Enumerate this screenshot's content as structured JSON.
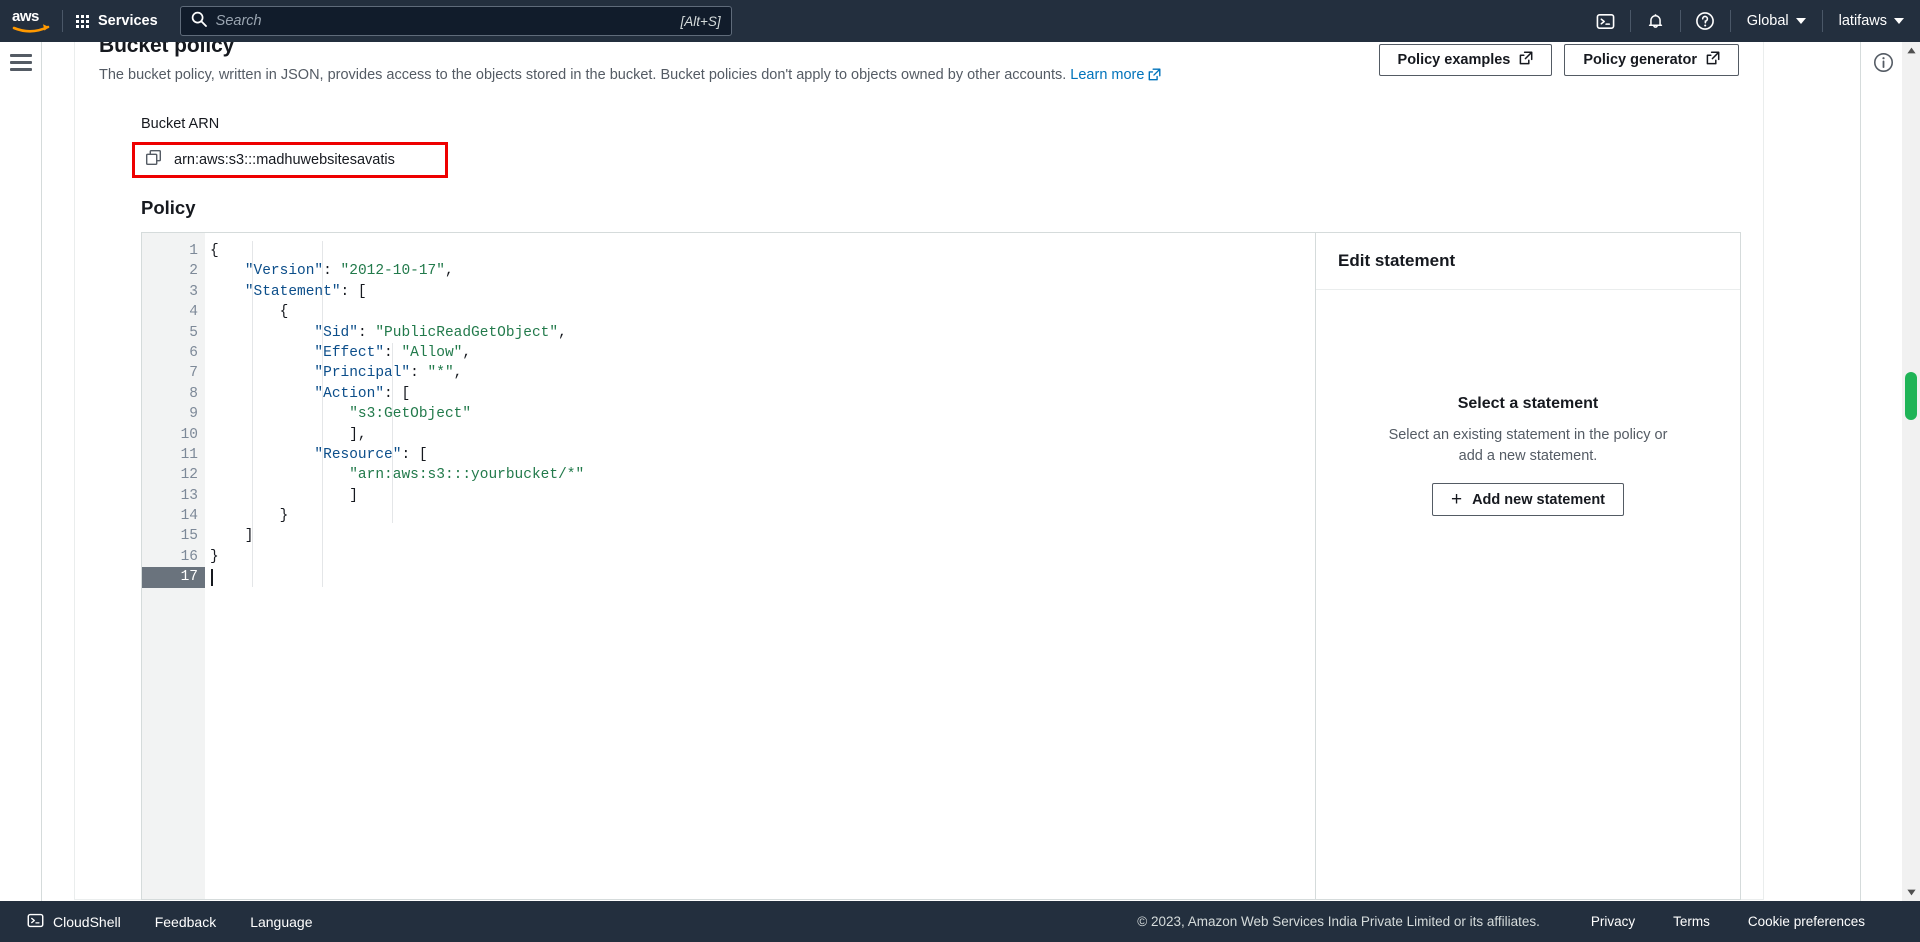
{
  "topnav": {
    "logo_alt": "aws-logo",
    "services_label": "Services",
    "search": {
      "placeholder": "Search",
      "value": "",
      "shortcut": "[Alt+S]"
    },
    "cloudshell_icon": "cloudshell-terminal-icon",
    "notifications_icon": "bell-icon",
    "help_icon": "question-circle-icon",
    "region_label": "Global",
    "account_label": "latifaws"
  },
  "leftrail": {
    "menu_icon": "hamburger-menu-icon"
  },
  "page": {
    "title": "Bucket policy",
    "description_before_link": "The bucket policy, written in JSON, provides access to the objects stored in the bucket. Bucket policies don't apply to objects owned by other accounts. ",
    "learn_more_label": "Learn more",
    "learn_more_icon": "external-link-icon",
    "policy_examples_label": "Policy examples",
    "policy_generator_label": "Policy generator",
    "external_icon": "external-link-icon"
  },
  "bucket_arn": {
    "label": "Bucket ARN",
    "value": "arn:aws:s3:::madhuwebsitesavatis",
    "copy_icon": "copy-icon",
    "highlight_color": "#ee0000"
  },
  "policy_section": {
    "label": "Policy"
  },
  "editor": {
    "active_line": 17,
    "cursor_line": 17,
    "lines": [
      {
        "num": 1,
        "foldable": true,
        "tokens": [
          {
            "t": "pun",
            "v": "{"
          }
        ]
      },
      {
        "num": 2,
        "foldable": false,
        "tokens": [
          {
            "t": "pun",
            "v": "    "
          },
          {
            "t": "key",
            "v": "\"Version\""
          },
          {
            "t": "pun",
            "v": ": "
          },
          {
            "t": "str",
            "v": "\"2012-10-17\""
          },
          {
            "t": "pun",
            "v": ","
          }
        ]
      },
      {
        "num": 3,
        "foldable": true,
        "tokens": [
          {
            "t": "pun",
            "v": "    "
          },
          {
            "t": "key",
            "v": "\"Statement\""
          },
          {
            "t": "pun",
            "v": ": ["
          }
        ]
      },
      {
        "num": 4,
        "foldable": true,
        "tokens": [
          {
            "t": "pun",
            "v": "        {"
          }
        ]
      },
      {
        "num": 5,
        "foldable": false,
        "tokens": [
          {
            "t": "pun",
            "v": "            "
          },
          {
            "t": "key",
            "v": "\"Sid\""
          },
          {
            "t": "pun",
            "v": ": "
          },
          {
            "t": "str",
            "v": "\"PublicReadGetObject\""
          },
          {
            "t": "pun",
            "v": ","
          }
        ]
      },
      {
        "num": 6,
        "foldable": false,
        "tokens": [
          {
            "t": "pun",
            "v": "            "
          },
          {
            "t": "key",
            "v": "\"Effect\""
          },
          {
            "t": "pun",
            "v": ": "
          },
          {
            "t": "str",
            "v": "\"Allow\""
          },
          {
            "t": "pun",
            "v": ","
          }
        ]
      },
      {
        "num": 7,
        "foldable": false,
        "tokens": [
          {
            "t": "pun",
            "v": "            "
          },
          {
            "t": "key",
            "v": "\"Principal\""
          },
          {
            "t": "pun",
            "v": ": "
          },
          {
            "t": "str",
            "v": "\"*\""
          },
          {
            "t": "pun",
            "v": ","
          }
        ]
      },
      {
        "num": 8,
        "foldable": true,
        "tokens": [
          {
            "t": "pun",
            "v": "            "
          },
          {
            "t": "key",
            "v": "\"Action\""
          },
          {
            "t": "pun",
            "v": ": ["
          }
        ]
      },
      {
        "num": 9,
        "foldable": false,
        "tokens": [
          {
            "t": "pun",
            "v": "                "
          },
          {
            "t": "str",
            "v": "\"s3:GetObject\""
          }
        ]
      },
      {
        "num": 10,
        "foldable": false,
        "tokens": [
          {
            "t": "pun",
            "v": "                ],"
          }
        ]
      },
      {
        "num": 11,
        "foldable": true,
        "tokens": [
          {
            "t": "pun",
            "v": "            "
          },
          {
            "t": "key",
            "v": "\"Resource\""
          },
          {
            "t": "pun",
            "v": ": ["
          }
        ]
      },
      {
        "num": 12,
        "foldable": false,
        "tokens": [
          {
            "t": "pun",
            "v": "                "
          },
          {
            "t": "str",
            "v": "\"arn:aws:s3:::yourbucket/*\""
          }
        ]
      },
      {
        "num": 13,
        "foldable": false,
        "tokens": [
          {
            "t": "pun",
            "v": "                ]"
          }
        ]
      },
      {
        "num": 14,
        "foldable": false,
        "tokens": [
          {
            "t": "pun",
            "v": "        }"
          }
        ]
      },
      {
        "num": 15,
        "foldable": false,
        "tokens": [
          {
            "t": "pun",
            "v": "    ]"
          }
        ]
      },
      {
        "num": 16,
        "foldable": false,
        "tokens": [
          {
            "t": "pun",
            "v": "}"
          }
        ]
      },
      {
        "num": 17,
        "foldable": false,
        "tokens": [
          {
            "t": "pun",
            "v": ""
          }
        ]
      }
    ]
  },
  "statement_panel": {
    "header": "Edit statement",
    "empty_title": "Select a statement",
    "empty_subtitle": "Select an existing statement in the policy or add a new statement.",
    "add_button_label": "Add new statement",
    "add_button_icon": "plus-icon"
  },
  "rightrail": {
    "info_icon": "info-circle-icon"
  },
  "scrollbar": {
    "thumb_color": "#1fb457",
    "up_icon": "caret-up-icon",
    "down_icon": "caret-down-icon"
  },
  "footer": {
    "cloudshell_label": "CloudShell",
    "cloudshell_icon": "cloudshell-terminal-icon",
    "feedback_label": "Feedback",
    "language_label": "Language",
    "copyright": "© 2023, Amazon Web Services India Private Limited or its affiliates.",
    "privacy_label": "Privacy",
    "terms_label": "Terms",
    "cookie_label": "Cookie preferences"
  }
}
